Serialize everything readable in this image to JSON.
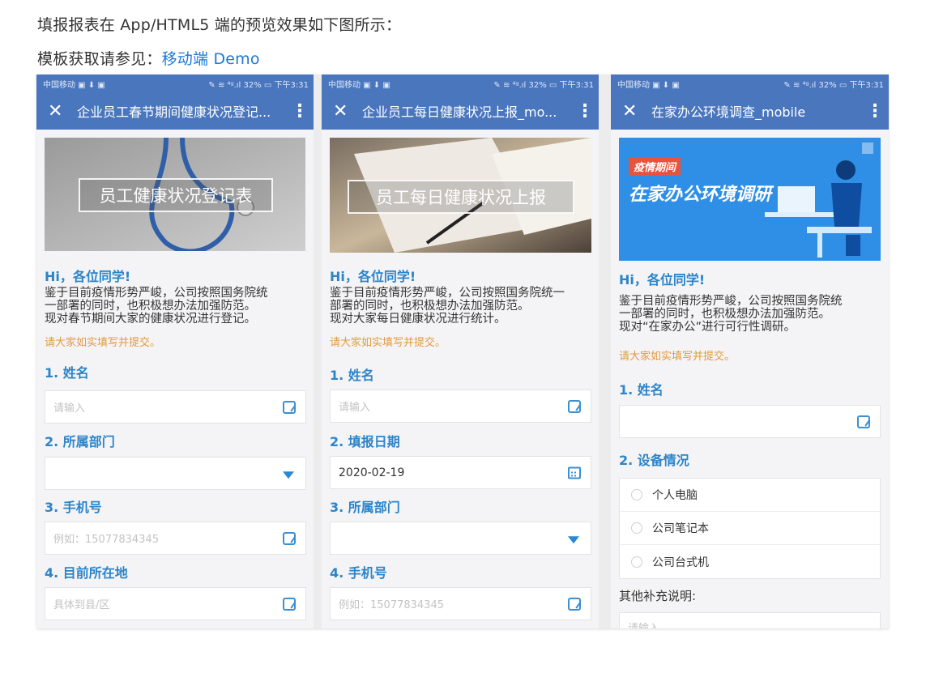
{
  "doc": {
    "line1": "填报报表在 App/HTML5 端的预览效果如下图所示：",
    "line2_prefix": "模板获取请参见：",
    "line2_link": "移动端 Demo"
  },
  "phones": [
    {
      "status_left": "中国移动 ▣ ⬇ ▣",
      "status_right": "✎ ≋ ⁴ᵍ.ıl 32% ▭ 下午3:31",
      "title": "企业员工春节期间健康状况登记...",
      "banner_text": "员工健康状况登记表",
      "hi": "Hi，各位同学!",
      "intro": [
        "鉴于目前疫情形势严峻，公司按照国务院统",
        "一部署的同时，也积极想办法加强防范。",
        "现对春节期间大家的健康状况进行登记。"
      ],
      "note": "请大家如实填写并提交。",
      "questions": [
        {
          "label": "1. 姓名",
          "placeholder": "请输入",
          "value": "",
          "icon": "scan"
        },
        {
          "label": "2. 所属部门",
          "placeholder": "",
          "value": "",
          "icon": "dropdown"
        },
        {
          "label": "3. 手机号",
          "placeholder": "例如：15077834345",
          "value": "",
          "icon": "scan"
        },
        {
          "label": "4. 目前所在地",
          "placeholder": "具体到县/区",
          "value": "",
          "icon": "scan"
        }
      ]
    },
    {
      "status_left": "中国移动 ▣ ⬇ ▣",
      "status_right": "✎ ≋ ⁴ᵍ.ıl 32% ▭ 下午3:31",
      "title": "企业员工每日健康状况上报_mo...",
      "banner_text": "员工每日健康状况上报",
      "hi": "Hi，各位同学!",
      "intro": [
        "鉴于目前疫情形势严峻，公司按照国务院统一",
        "部署的同时，也积极想办法加强防范。",
        "现对大家每日健康状况进行统计。"
      ],
      "note": "请大家如实填写并提交。",
      "questions": [
        {
          "label": "1. 姓名",
          "placeholder": "请输入",
          "value": "",
          "icon": "scan"
        },
        {
          "label": "2. 填报日期",
          "placeholder": "",
          "value": "2020-02-19",
          "icon": "calendar"
        },
        {
          "label": "3. 所属部门",
          "placeholder": "",
          "value": "",
          "icon": "dropdown"
        },
        {
          "label": "4. 手机号",
          "placeholder": "例如：15077834345",
          "value": "",
          "icon": "scan"
        }
      ]
    },
    {
      "status_left": "中国移动 ▣ ⬇ ▣",
      "status_right": "✎ ≋ ⁴ᵍ.ıl 32% ▭ 下午3:31",
      "title": "在家办公环境调查_mobile",
      "banner_tag": "疫情期间",
      "banner_text": "在家办公环境调研",
      "hi": "Hi，各位同学!",
      "intro": [
        "鉴于目前疫情形势严峻，公司按照国务院统",
        "一部署的同时，也积极想办法加强防范。",
        "现对“在家办公”进行可行性调研。"
      ],
      "note": "请大家如实填写并提交。",
      "q1_label": "1. 姓名",
      "q2_label": "2. 设备情况",
      "options": [
        "个人电脑",
        "公司笔记本",
        "公司台式机"
      ],
      "extra_label": "其他补充说明:",
      "extra_placeholder": "请输入"
    }
  ]
}
